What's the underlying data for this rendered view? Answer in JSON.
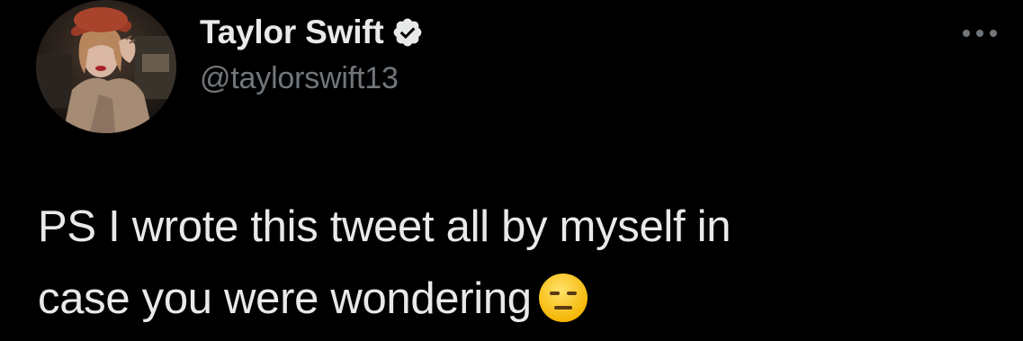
{
  "author": {
    "display_name": "Taylor Swift",
    "handle": "@taylorswift13",
    "verified": true,
    "avatar_icon": "profile-photo"
  },
  "tweet": {
    "line1": "PS I wrote this tweet all by myself in",
    "line2": "case you were wondering",
    "emoji": "expressionless-face"
  },
  "icons": {
    "more": "more-options-icon",
    "verified": "verified-badge-icon"
  },
  "colors": {
    "background": "#000000",
    "text_primary": "#e7e9ea",
    "text_secondary": "#71767b",
    "verified_fill": "#e7e9ea"
  }
}
